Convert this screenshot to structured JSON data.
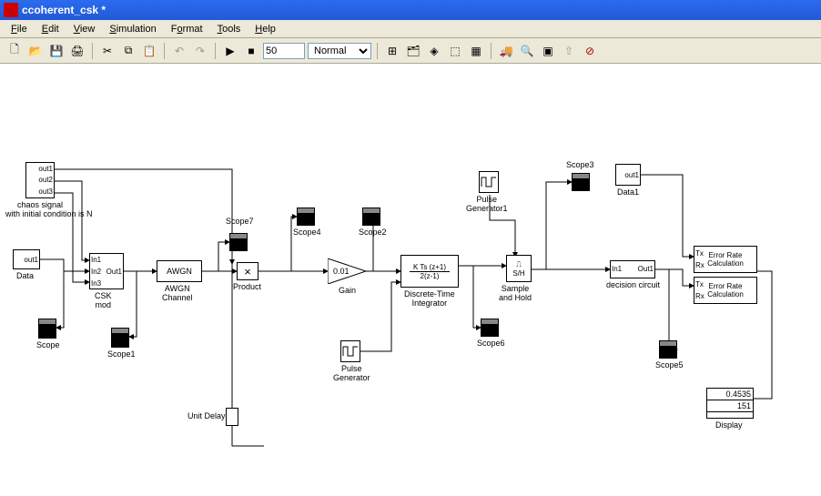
{
  "window": {
    "title": "ccoherent_csk *"
  },
  "menu": {
    "file": "File",
    "edit": "Edit",
    "view": "View",
    "simulation": "Simulation",
    "format": "Format",
    "tools": "Tools",
    "help": "Help"
  },
  "toolbar": {
    "stoptime": "50",
    "mode": "Normal"
  },
  "blocks": {
    "chaos": {
      "out1": "out1",
      "out2": "out2",
      "out3": "out3",
      "label": "chaos signal\nwith initial condition is N"
    },
    "data": {
      "out": "out1",
      "label": "Data"
    },
    "scope": {
      "label": "Scope"
    },
    "scope1": {
      "label": "Scope1"
    },
    "scope2": {
      "label": "Scope2"
    },
    "scope3": {
      "label": "Scope3"
    },
    "scope4": {
      "label": "Scope4"
    },
    "scope5": {
      "label": "Scope5"
    },
    "scope6": {
      "label": "Scope6"
    },
    "scope7": {
      "label": "Scope7"
    },
    "cskmod": {
      "in1": "In1",
      "in2": "In2",
      "in3": "In3",
      "out": "Out1",
      "label": "CSK\nmod"
    },
    "awgn": {
      "text": "AWGN",
      "label": "AWGN\nChannel"
    },
    "product": {
      "sym": "×",
      "label": "Product"
    },
    "gain": {
      "val": "0.01",
      "label": "Gain"
    },
    "integrator": {
      "text": "K Ts (z+1)\n2(z-1)",
      "label": "Discrete-Time\nIntegrator"
    },
    "pulsegen": {
      "label": "Pulse\nGenerator"
    },
    "pulsegen1": {
      "label": "Pulse\nGenerator1"
    },
    "sh": {
      "text": "S/H",
      "label": "Sample\nand Hold"
    },
    "decision": {
      "in": "In1",
      "out": "Out1",
      "label": "decision circuit"
    },
    "data1": {
      "out": "out1",
      "label": "Data1"
    },
    "err1": {
      "text": "Error Rate\nCalculation",
      "tx": "Tx",
      "rx": "Rx"
    },
    "err2": {
      "text": "Error Rate\nCalculation",
      "tx": "Tx",
      "rx": "Rx"
    },
    "display": {
      "v1": "0.4535",
      "v2": "151",
      "label": "Display"
    },
    "unitdelay": {
      "label": "Unit Delay"
    }
  }
}
